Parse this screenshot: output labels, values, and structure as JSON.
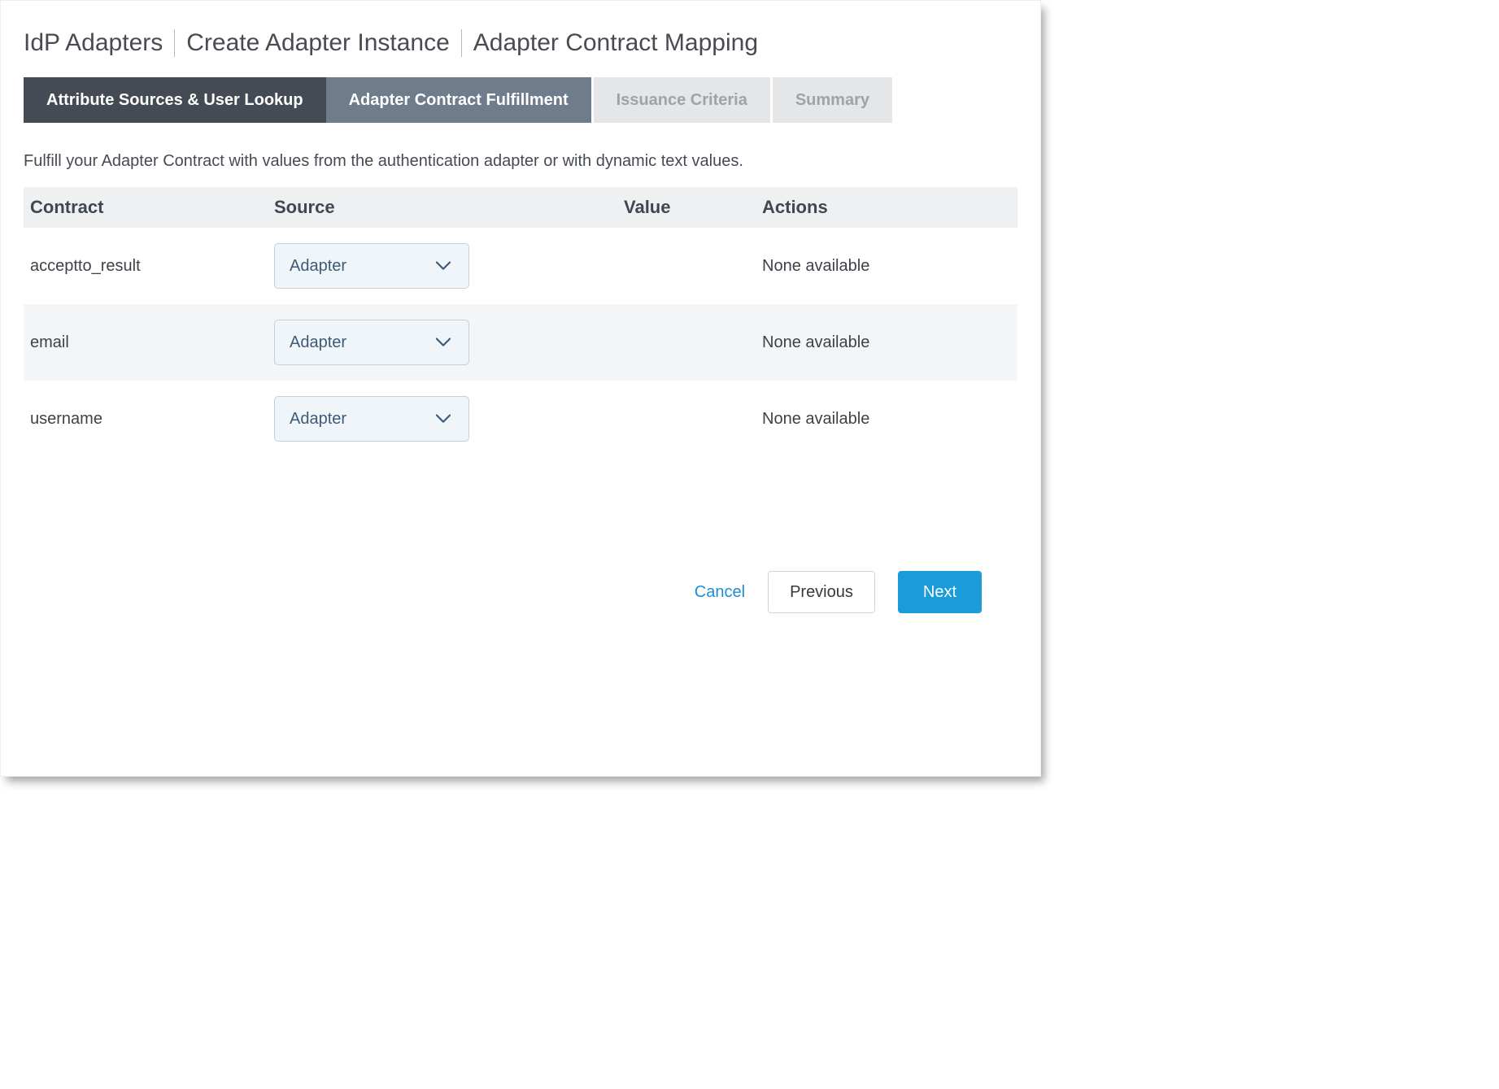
{
  "breadcrumb": {
    "items": [
      "IdP Adapters",
      "Create Adapter Instance",
      "Adapter Contract Mapping"
    ]
  },
  "tabs": [
    {
      "label": "Attribute Sources & User Lookup",
      "state": "completed"
    },
    {
      "label": "Adapter Contract Fulfillment",
      "state": "active"
    },
    {
      "label": "Issuance Criteria",
      "state": "upcoming"
    },
    {
      "label": "Summary",
      "state": "upcoming"
    }
  ],
  "help_text": "Fulfill your Adapter Contract with values from the authentication adapter or with dynamic text values.",
  "table": {
    "headers": {
      "contract": "Contract",
      "source": "Source",
      "value": "Value",
      "actions": "Actions"
    },
    "rows": [
      {
        "contract": "acceptto_result",
        "source": "Adapter",
        "value": "",
        "actions": "None available"
      },
      {
        "contract": "email",
        "source": "Adapter",
        "value": "",
        "actions": "None available"
      },
      {
        "contract": "username",
        "source": "Adapter",
        "value": "",
        "actions": "None available"
      }
    ]
  },
  "footer": {
    "cancel": "Cancel",
    "previous": "Previous",
    "next": "Next"
  },
  "colors": {
    "tab_completed_bg": "#454b54",
    "tab_active_bg": "#6e7c8b",
    "tab_upcoming_bg": "#e5e6e7",
    "primary_button": "#1a9cd8",
    "link": "#1b8dd6",
    "select_bg": "#eff5f8",
    "select_border": "#c6d0d8",
    "select_text": "#3e5a78"
  }
}
